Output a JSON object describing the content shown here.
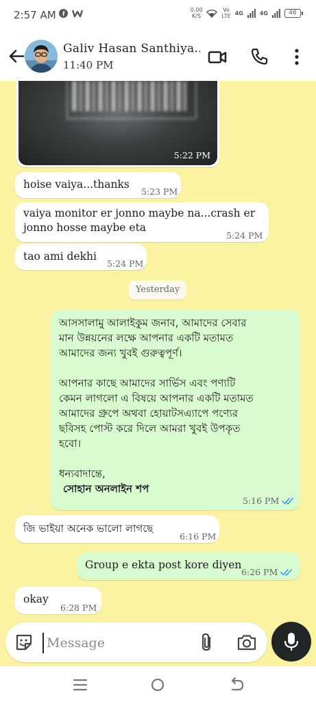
{
  "status_bar": {
    "time": "2:57 AM",
    "net_speed_value": "0.00",
    "net_speed_unit": "K/S",
    "volte_top": "Vo",
    "volte_bottom": "LTE",
    "signal1": "4G",
    "signal2": "4G",
    "battery": "46"
  },
  "header": {
    "contact_name": "Galiv Hasan Santhiya...",
    "last_seen": "11:40 PM"
  },
  "messages": {
    "m0": {
      "time": "5:22 PM"
    },
    "m1": {
      "text": "hoise vaiya...thanks",
      "time": "5:23 PM"
    },
    "m2": {
      "line1": "vaiya monitor er jonno maybe na...crash er",
      "line2": "jonno hosse maybe eta",
      "time": "5:24 PM"
    },
    "m3": {
      "text": "tao ami dekhi",
      "time": "5:24 PM"
    },
    "day": "Yesterday",
    "m4": {
      "lines": [
        "আসসালামু আলাইকুম জনাব, আমাদের সেবার",
        "মান উন্নয়নের লক্ষে আপনার একটি মতামত",
        "আমাদের জন্য খুবই গুরুত্বপূর্ণ।",
        "",
        "আপনার কাছে আমাদের সার্ভিস এবং পণ্যটি",
        "কেমন লাগলো এ বিষয়ে আপনার একটি মতামত",
        "আমাদের গ্রুপে অথবা হোয়াটসএ্যাপে পণ্যের",
        "ছবিসহ পোস্ট করে দিলে আমরা খুবই উপকৃত",
        "হবো।",
        "",
        "ধন্যবাদান্তে,"
      ],
      "signature": "সোহান অনলাইন শপ",
      "time": "5:16 PM"
    },
    "m5": {
      "text": "জি ভাইয়া অনেক ভালো লাগছে",
      "time": "6:16 PM"
    },
    "m6": {
      "text": "Group e ekta post kore diyen",
      "time": "6:26 PM"
    },
    "m7": {
      "text": "okay",
      "time": "6:28 PM"
    }
  },
  "composer": {
    "placeholder": "Message"
  },
  "colors": {
    "wallpaper": "#fbf3a2",
    "outgoing_bubble": "#d8fbcf",
    "incoming_bubble": "#ffffff",
    "read_ticks": "#3497f9",
    "mic_button": "#1f2625"
  }
}
